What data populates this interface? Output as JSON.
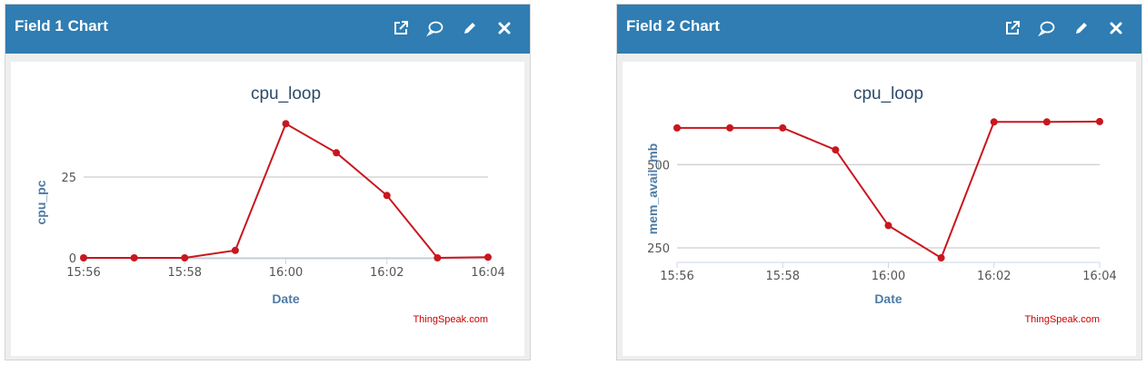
{
  "panels": [
    {
      "header_title": "Field 1 Chart",
      "icons": [
        "popout-icon",
        "comment-icon",
        "edit-icon",
        "close-icon"
      ],
      "credit": "ThingSpeak.com"
    },
    {
      "header_title": "Field 2 Chart",
      "icons": [
        "popout-icon",
        "comment-icon",
        "edit-icon",
        "close-icon"
      ],
      "credit": "ThingSpeak.com"
    }
  ],
  "colors": {
    "header": "#2f7db2",
    "series": "#c8171e",
    "grid": "#c0c0c0",
    "title": "#2c4a69",
    "axis_label": "#4d7ba6",
    "credit": "#cc0000"
  },
  "chart_data": [
    {
      "type": "line",
      "title": "cpu_loop",
      "xlabel": "Date",
      "ylabel": "cpu_pc",
      "x": [
        "15:56",
        "15:57",
        "15:58",
        "15:59",
        "16:00",
        "16:01",
        "16:02",
        "16:03",
        "16:04"
      ],
      "x_ticks": [
        "15:56",
        "15:58",
        "16:00",
        "16:02",
        "16:04"
      ],
      "y_ticks": [
        0,
        25
      ],
      "ylim": [
        0,
        50
      ],
      "grid": true,
      "series": [
        {
          "values": [
            0,
            0,
            0,
            2.3,
            41.5,
            32.5,
            19.3,
            0,
            0.2
          ]
        }
      ]
    },
    {
      "type": "line",
      "title": "cpu_loop",
      "xlabel": "Date",
      "ylabel": "mem_avail_mb",
      "x": [
        "15:56",
        "15:57",
        "15:58",
        "15:59",
        "16:00",
        "16:01",
        "16:02",
        "16:03",
        "16:04"
      ],
      "x_ticks": [
        "15:56",
        "15:58",
        "16:00",
        "16:02",
        "16:04"
      ],
      "y_ticks": [
        250,
        500
      ],
      "ylim": [
        200,
        680
      ],
      "grid": true,
      "series": [
        {
          "values": [
            610,
            610,
            610,
            544,
            317,
            220,
            628,
            628,
            629
          ]
        }
      ]
    }
  ]
}
